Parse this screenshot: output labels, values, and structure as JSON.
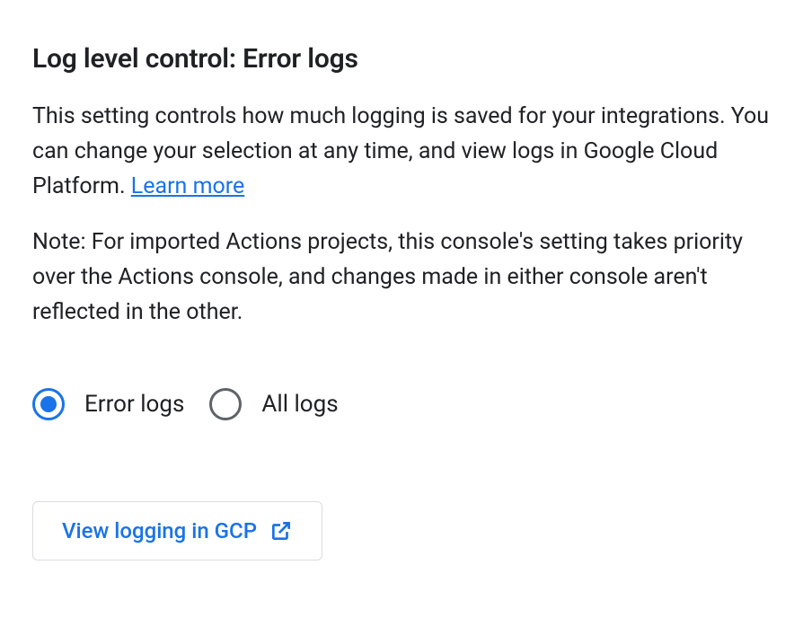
{
  "heading": "Log level control: Error logs",
  "description_part1": "This setting controls how much logging is saved for your integrations. You can change your selection at any time, and view logs in Google Cloud Platform. ",
  "description_link": "Learn more",
  "note": "Note: For imported Actions projects, this console's setting takes priority over the Actions console, and changes made in either console aren't reflected in the other.",
  "radio": {
    "options": [
      {
        "label": "Error logs",
        "selected": true
      },
      {
        "label": "All logs",
        "selected": false
      }
    ]
  },
  "button": {
    "label": "View logging in GCP"
  }
}
